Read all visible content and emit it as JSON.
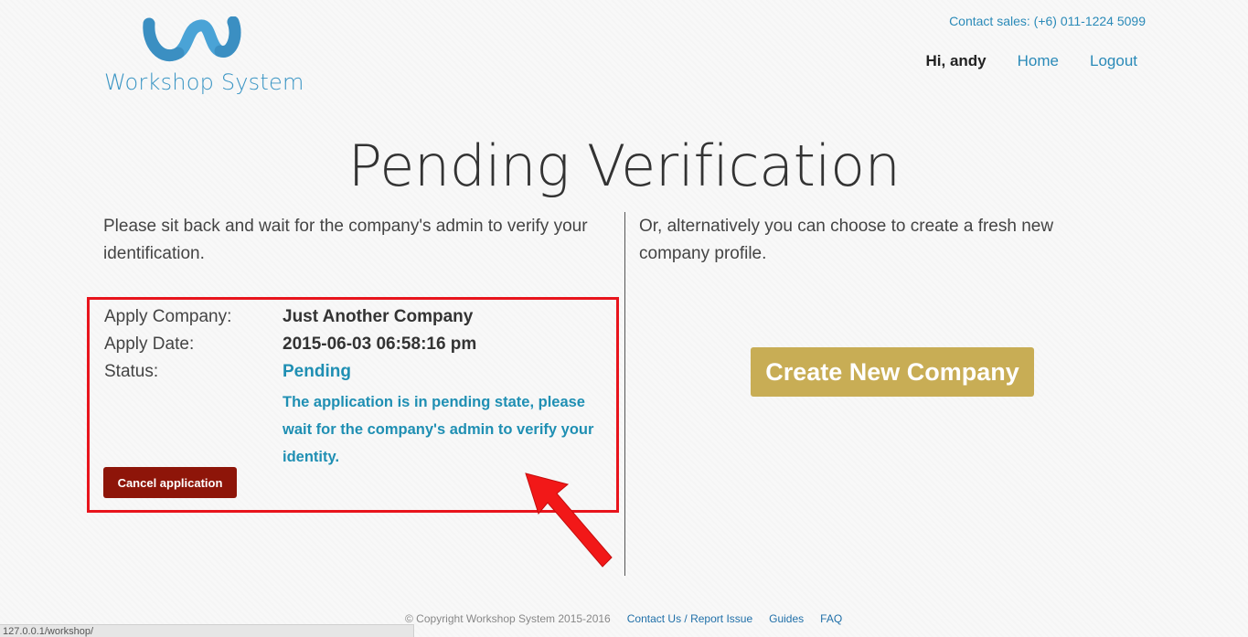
{
  "header": {
    "logo_text": "Workshop System",
    "contact_sales": "Contact sales: (+6) 011-1224 5099",
    "greeting": "Hi, andy",
    "nav": {
      "home": "Home",
      "logout": "Logout"
    }
  },
  "main": {
    "title": "Pending Verification",
    "intro_left": "Please sit back and wait for the company's admin to verify your identification.",
    "intro_right": "Or, alternatively you can choose to create a fresh new company profile.",
    "application": {
      "company_label": "Apply Company:",
      "company_value": "Just Another Company",
      "date_label": "Apply Date:",
      "date_value": "2015-06-03 06:58:16 pm",
      "status_label": "Status:",
      "status_value": "Pending",
      "status_message": "The application is in pending state, please wait for the company's admin to verify your identity.",
      "cancel_label": "Cancel application"
    },
    "create_label": "Create New Company"
  },
  "footer": {
    "copyright": "© Copyright Workshop System 2015-2016",
    "links": {
      "contact": "Contact Us / Report Issue",
      "guides": "Guides",
      "faq": "FAQ"
    }
  },
  "browser": {
    "status_url": "127.0.0.1/workshop/"
  },
  "colors": {
    "accent": "#2a8ab8",
    "status": "#1f8fb3",
    "highlight_border": "#e8141c",
    "cancel_button": "#8e1509",
    "create_button": "#c8ad55"
  }
}
